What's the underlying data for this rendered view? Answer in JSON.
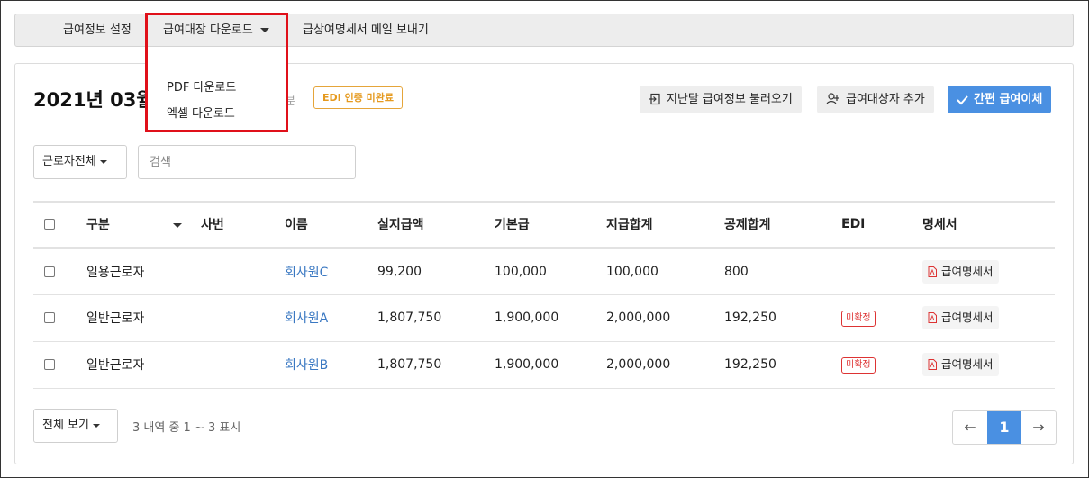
{
  "nav": {
    "items": [
      {
        "label": "급여정보 설정"
      },
      {
        "label": "급여대장 다운로드"
      },
      {
        "label": "급상여명세서 메일 보내기"
      }
    ],
    "dropdown": {
      "items": [
        {
          "label": "PDF 다운로드"
        },
        {
          "label": "엑셀 다운로드"
        }
      ]
    }
  },
  "header": {
    "title": "2021년 03월",
    "sub": "분",
    "edi_badge": "EDI 인증 미완료",
    "buttons": {
      "load_prev": "지난달 급여정보 불러오기",
      "add_target": "급여대상자 추가",
      "transfer": "간편 급여이체"
    }
  },
  "filters": {
    "worker_select": "근로자전체",
    "search_placeholder": "검색"
  },
  "table": {
    "columns": [
      "구분",
      "사번",
      "이름",
      "실지급액",
      "기본급",
      "지급합계",
      "공제합계",
      "EDI",
      "명세서"
    ],
    "rows": [
      {
        "type": "일용근로자",
        "emp_no": "",
        "name": "회사원C",
        "net": "99,200",
        "base": "100,000",
        "total_pay": "100,000",
        "deduction": "800",
        "edi": "",
        "doc": "급여명세서"
      },
      {
        "type": "일반근로자",
        "emp_no": "",
        "name": "회사원A",
        "net": "1,807,750",
        "base": "1,900,000",
        "total_pay": "2,000,000",
        "deduction": "192,250",
        "edi": "미확정",
        "doc": "급여명세서"
      },
      {
        "type": "일반근로자",
        "emp_no": "",
        "name": "회사원B",
        "net": "1,807,750",
        "base": "1,900,000",
        "total_pay": "2,000,000",
        "deduction": "192,250",
        "edi": "미확정",
        "doc": "급여명세서"
      }
    ]
  },
  "footer": {
    "view_all": "전체 보기",
    "count_text": "3 내역 중 1 ~ 3 표시",
    "pager": {
      "prev": "←",
      "page": "1",
      "next": "→"
    }
  },
  "colors": {
    "accent": "#4a90e2",
    "link": "#3a78c2",
    "warning": "#e59a1f",
    "danger": "#dd3333",
    "highlight": "#e0101a"
  }
}
